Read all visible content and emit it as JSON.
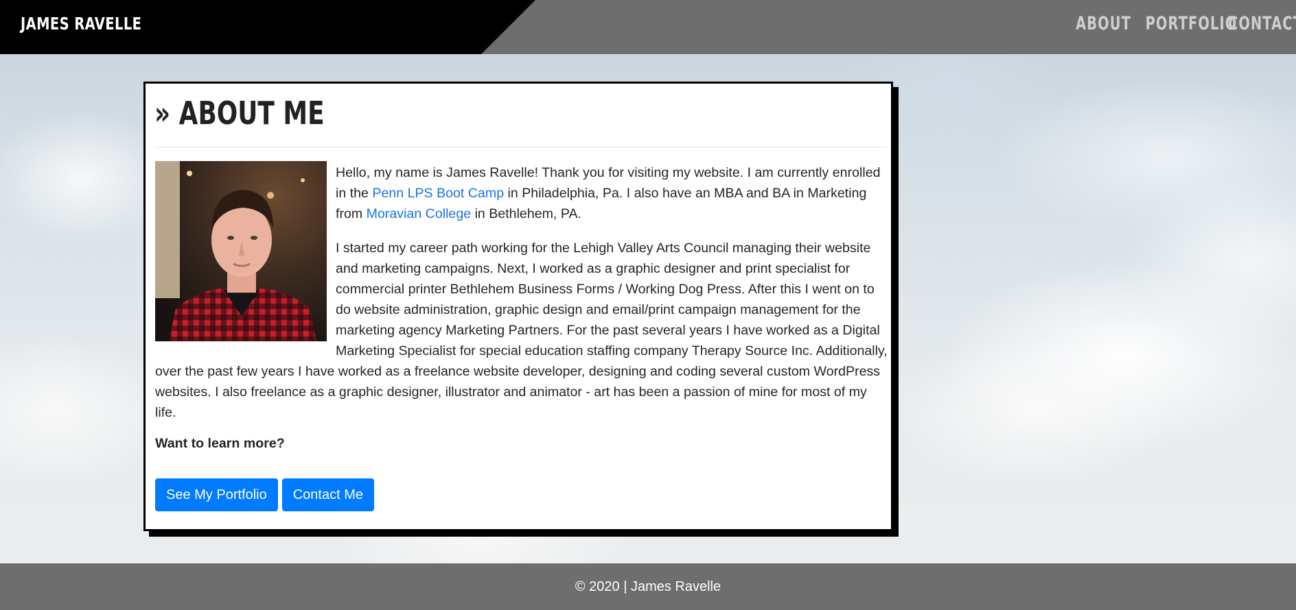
{
  "header": {
    "brand": "JAMES RAVELLE",
    "nav": {
      "about": "ABOUT",
      "portfolio": "PORTFOLIO",
      "contact": "CONTACT"
    }
  },
  "about": {
    "title": "» ABOUT ME",
    "p1": {
      "before": "Hello, my name is James Ravelle! Thank you for visiting my website. I am currently enrolled in the ",
      "link1": "Penn LPS Boot Camp",
      "middle": " in Philadelphia, Pa. I also have an MBA and BA in Marketing from ",
      "link2": "Moravian College",
      "after": " in Bethlehem, PA."
    },
    "p2": "I started my career path working for the Lehigh Valley Arts Council managing their website and marketing campaigns. Next, I worked as a graphic designer and print specialist for commercial printer Bethlehem Business Forms / Working Dog Press. After this I went on to do website administration, graphic design and email/print campaign management for the marketing agency Marketing Partners. For the past several years I have worked as a Digital Marketing Specialist for special education staffing company Therapy Source Inc. Additionally, over the past few years I have worked as a freelance website developer, designing and coding several custom WordPress websites. I also freelance as a graphic designer, illustrator and animator - art has been a passion of mine for most of my life.",
    "learn_more": "Want to learn more?",
    "buttons": {
      "portfolio": "See My Portfolio",
      "contact": "Contact Me"
    }
  },
  "footer": {
    "text": "© 2020 | James Ravelle"
  },
  "colors": {
    "header_black": "#000000",
    "header_gray": "#6e6e6e",
    "button_blue": "#007bff",
    "link_blue": "#1a73e8"
  }
}
